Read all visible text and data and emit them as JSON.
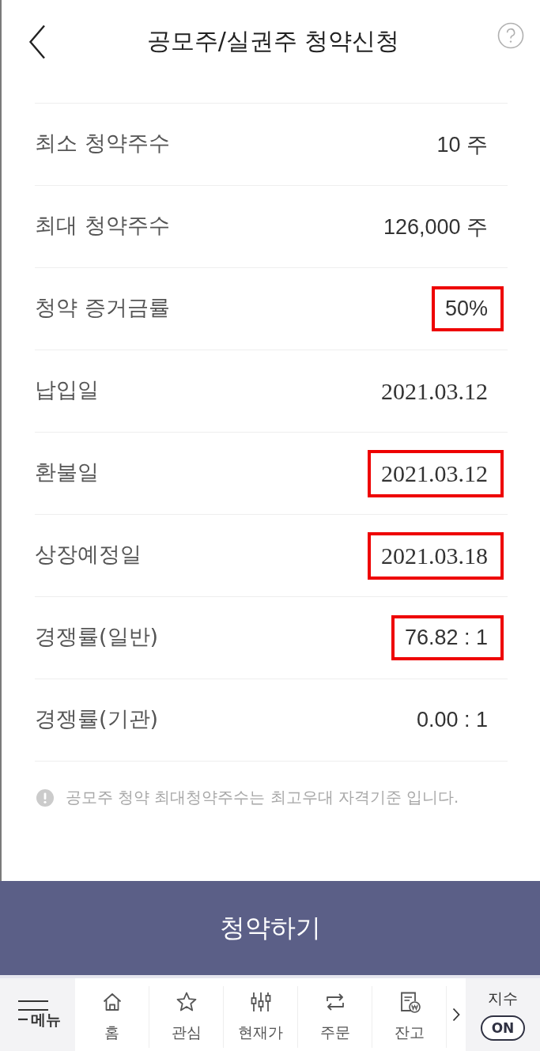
{
  "header": {
    "title": "공모주/실권주 청약신청"
  },
  "rows": [
    {
      "label": "최소 청약주수",
      "value": "10 주",
      "kind": "number",
      "highlighted": false
    },
    {
      "label": "최대 청약주수",
      "value": "126,000 주",
      "kind": "number",
      "highlighted": false
    },
    {
      "label": "청약 증거금률",
      "value": "50%",
      "kind": "number",
      "highlighted": true
    },
    {
      "label": "납입일",
      "value": "2021.03.12",
      "kind": "date",
      "highlighted": false
    },
    {
      "label": "환불일",
      "value": "2021.03.12",
      "kind": "date",
      "highlighted": true
    },
    {
      "label": "상장예정일",
      "value": "2021.03.18",
      "kind": "date",
      "highlighted": true
    },
    {
      "label": "경쟁률(일반)",
      "value": "76.82 : 1",
      "kind": "number",
      "highlighted": true
    },
    {
      "label": "경쟁률(기관)",
      "value": "0.00 : 1",
      "kind": "number",
      "highlighted": false
    }
  ],
  "notice": {
    "text": "공모주 청약 최대청약주수는 최고우대 자격기준 입니다."
  },
  "submit_button": {
    "label": "청약하기"
  },
  "bottom_nav": {
    "menu": {
      "label": "메뉴"
    },
    "items": [
      {
        "label": "홈"
      },
      {
        "label": "관심"
      },
      {
        "label": "현재가"
      },
      {
        "label": "주문"
      },
      {
        "label": "잔고"
      }
    ],
    "index_toggle": {
      "label": "지수",
      "state_text": "ON",
      "on": true
    }
  }
}
